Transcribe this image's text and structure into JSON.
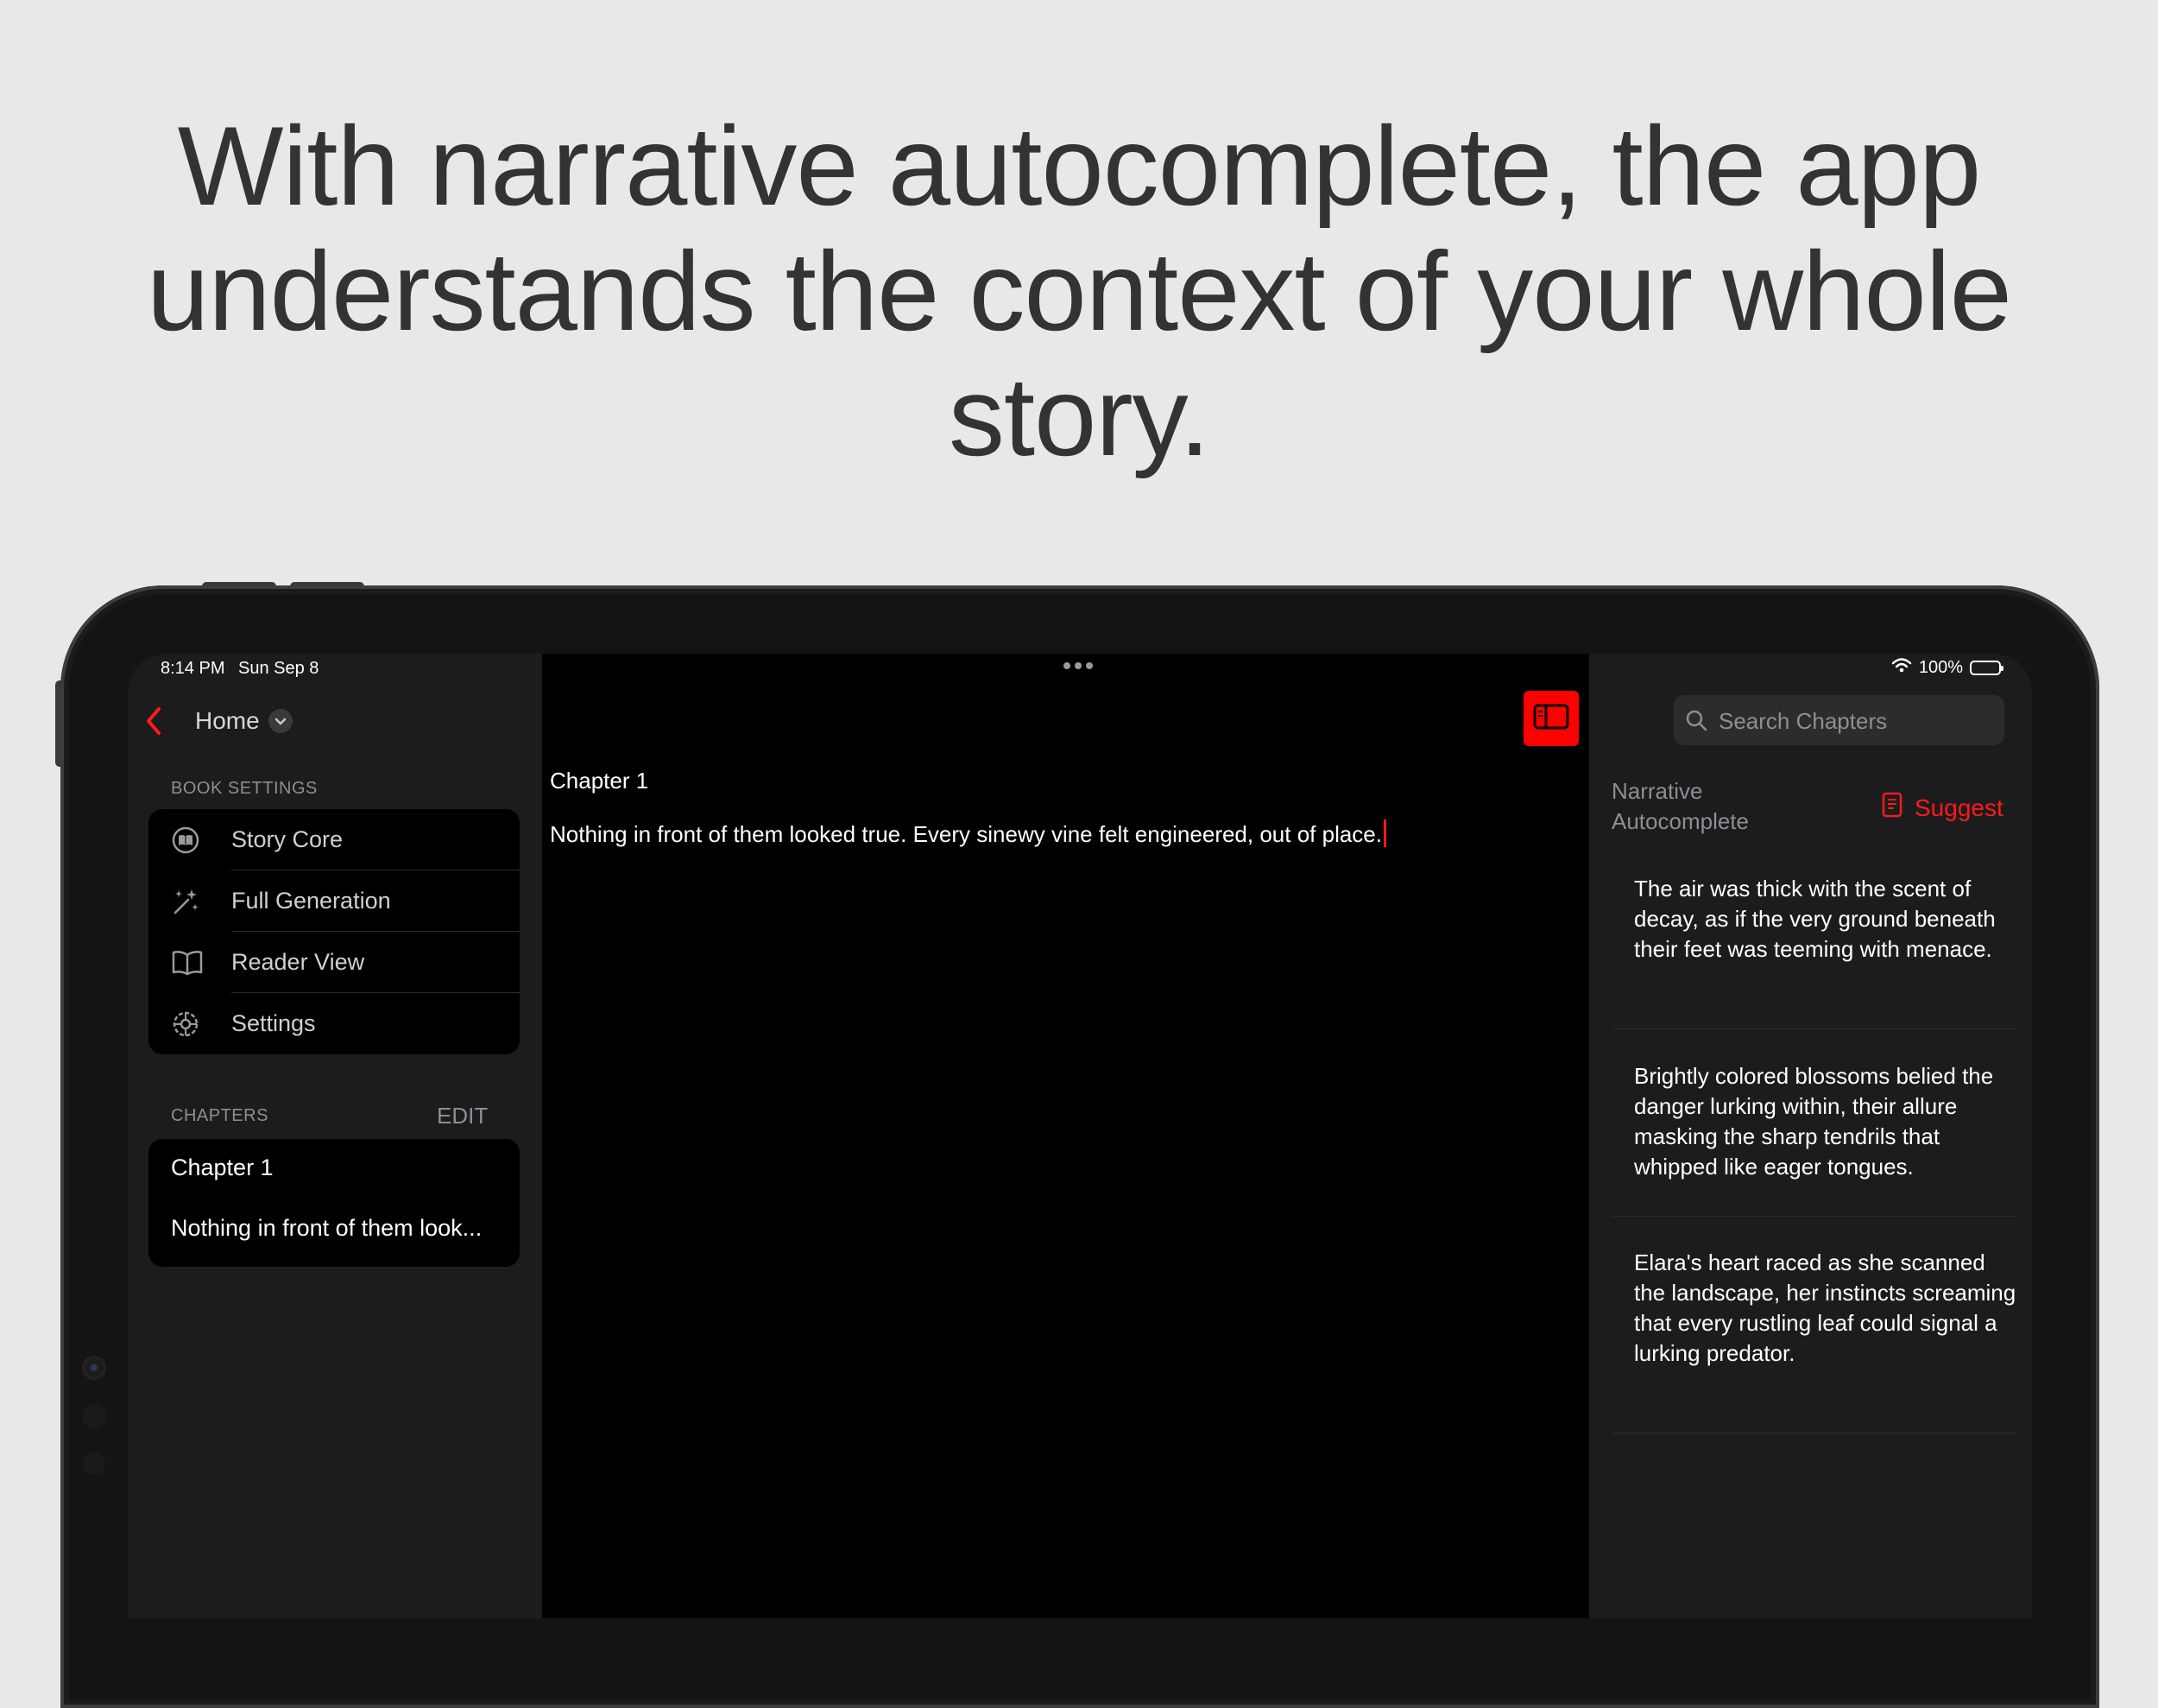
{
  "headline": {
    "line1": "With narrative autocomplete, the app",
    "line2": "understands the context of your whole",
    "line3": "story."
  },
  "status_bar": {
    "time": "8:14 PM",
    "date": "Sun Sep 8",
    "battery": "100%"
  },
  "sidebar": {
    "nav_title": "Home",
    "book_settings_label": "BOOK SETTINGS",
    "items": [
      {
        "label": "Story Core",
        "icon": "book-circle-icon"
      },
      {
        "label": "Full Generation",
        "icon": "magic-wand-icon"
      },
      {
        "label": "Reader View",
        "icon": "open-book-icon"
      },
      {
        "label": "Settings",
        "icon": "gear-icon"
      }
    ],
    "chapters_label": "CHAPTERS",
    "edit_label": "EDIT",
    "chapters": [
      {
        "title": "Chapter 1",
        "preview": "Nothing in front of them look..."
      }
    ]
  },
  "editor": {
    "chapter_title": "Chapter 1",
    "text": "Nothing in front of them looked true. Every sinewy vine felt engineered, out of place."
  },
  "right_panel": {
    "search_placeholder": "Search Chapters",
    "title": "Narrative Autocomplete",
    "suggest_label": "Suggest",
    "suggestions": [
      "The air was thick with the scent of decay, as if the very ground beneath their feet was teeming with menace.",
      "Brightly colored blossoms belied the danger lurking within, their allure masking the sharp tendrils that whipped like eager tongues.",
      "Elara's heart raced as she scanned the landscape, her instincts screaming that every rustling leaf could signal a lurking predator."
    ]
  },
  "colors": {
    "accent": "#ff0000",
    "background": "#e8e8e8",
    "panel": "#1c1c1e"
  }
}
